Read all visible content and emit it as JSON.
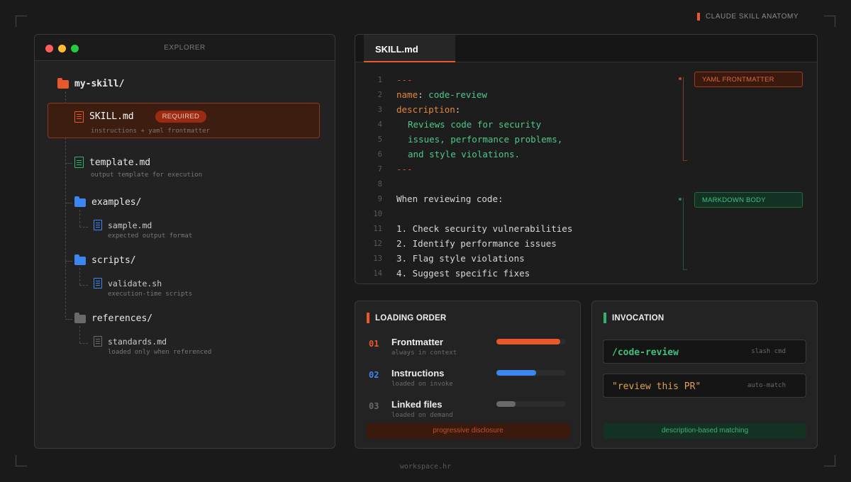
{
  "header": {
    "tag": "CLAUDE SKILL ANATOMY"
  },
  "footer": {
    "text": "workspace.hr"
  },
  "colors": {
    "accent": "#e8582a",
    "blue": "#3d86f0",
    "green": "#2fb36f"
  },
  "explorer": {
    "title": "EXPLORER",
    "root": {
      "name": "my-skill/",
      "icon": "folder-icon"
    },
    "skill": {
      "name": "SKILL.md",
      "badge": "REQUIRED",
      "sub": "instructions + yaml frontmatter"
    },
    "template": {
      "name": "template.md",
      "sub": "output template for execution"
    },
    "examples": {
      "name": "examples/",
      "file": "sample.md",
      "file_sub": "expected output format"
    },
    "scripts": {
      "name": "scripts/",
      "file": "validate.sh",
      "file_sub": "execution-time scripts"
    },
    "references": {
      "name": "references/",
      "file": "standards.md",
      "file_sub": "loaded only when referenced"
    }
  },
  "editor": {
    "tab": "SKILL.md",
    "line_numbers": [
      "1",
      "2",
      "3",
      "4",
      "5",
      "6",
      "7",
      "8",
      "9",
      "10",
      "11",
      "12",
      "13",
      "14"
    ],
    "frontmatter": {
      "open": "---",
      "name_key": "name",
      "name_value": "code-review",
      "desc_key": "description",
      "desc_lines": [
        "Reviews code for security",
        "issues, performance problems,",
        "and style violations."
      ],
      "close": "---"
    },
    "body": {
      "intro": "When reviewing code:",
      "items": [
        "1. Check security vulnerabilities",
        "2. Identify performance issues",
        "3. Flag style violations",
        "4. Suggest specific fixes"
      ]
    },
    "annotations": {
      "frontmatter": "YAML FRONTMATTER",
      "body": "MARKDOWN BODY"
    }
  },
  "loading_order": {
    "title": "LOADING ORDER",
    "items": [
      {
        "num": "01",
        "name": "Frontmatter",
        "sub": "always in context",
        "level": 0.92
      },
      {
        "num": "02",
        "name": "Instructions",
        "sub": "loaded on invoke",
        "level": 0.57
      },
      {
        "num": "03",
        "name": "Linked files",
        "sub": "loaded on demand",
        "level": 0.28
      }
    ],
    "footer": "progressive disclosure"
  },
  "invocation": {
    "title": "INVOCATION",
    "items": [
      {
        "cmd": "/code-review",
        "tag": "slash cmd"
      },
      {
        "cmd": "\"review this PR\"",
        "tag": "auto-match"
      }
    ],
    "footer": "description-based matching"
  }
}
